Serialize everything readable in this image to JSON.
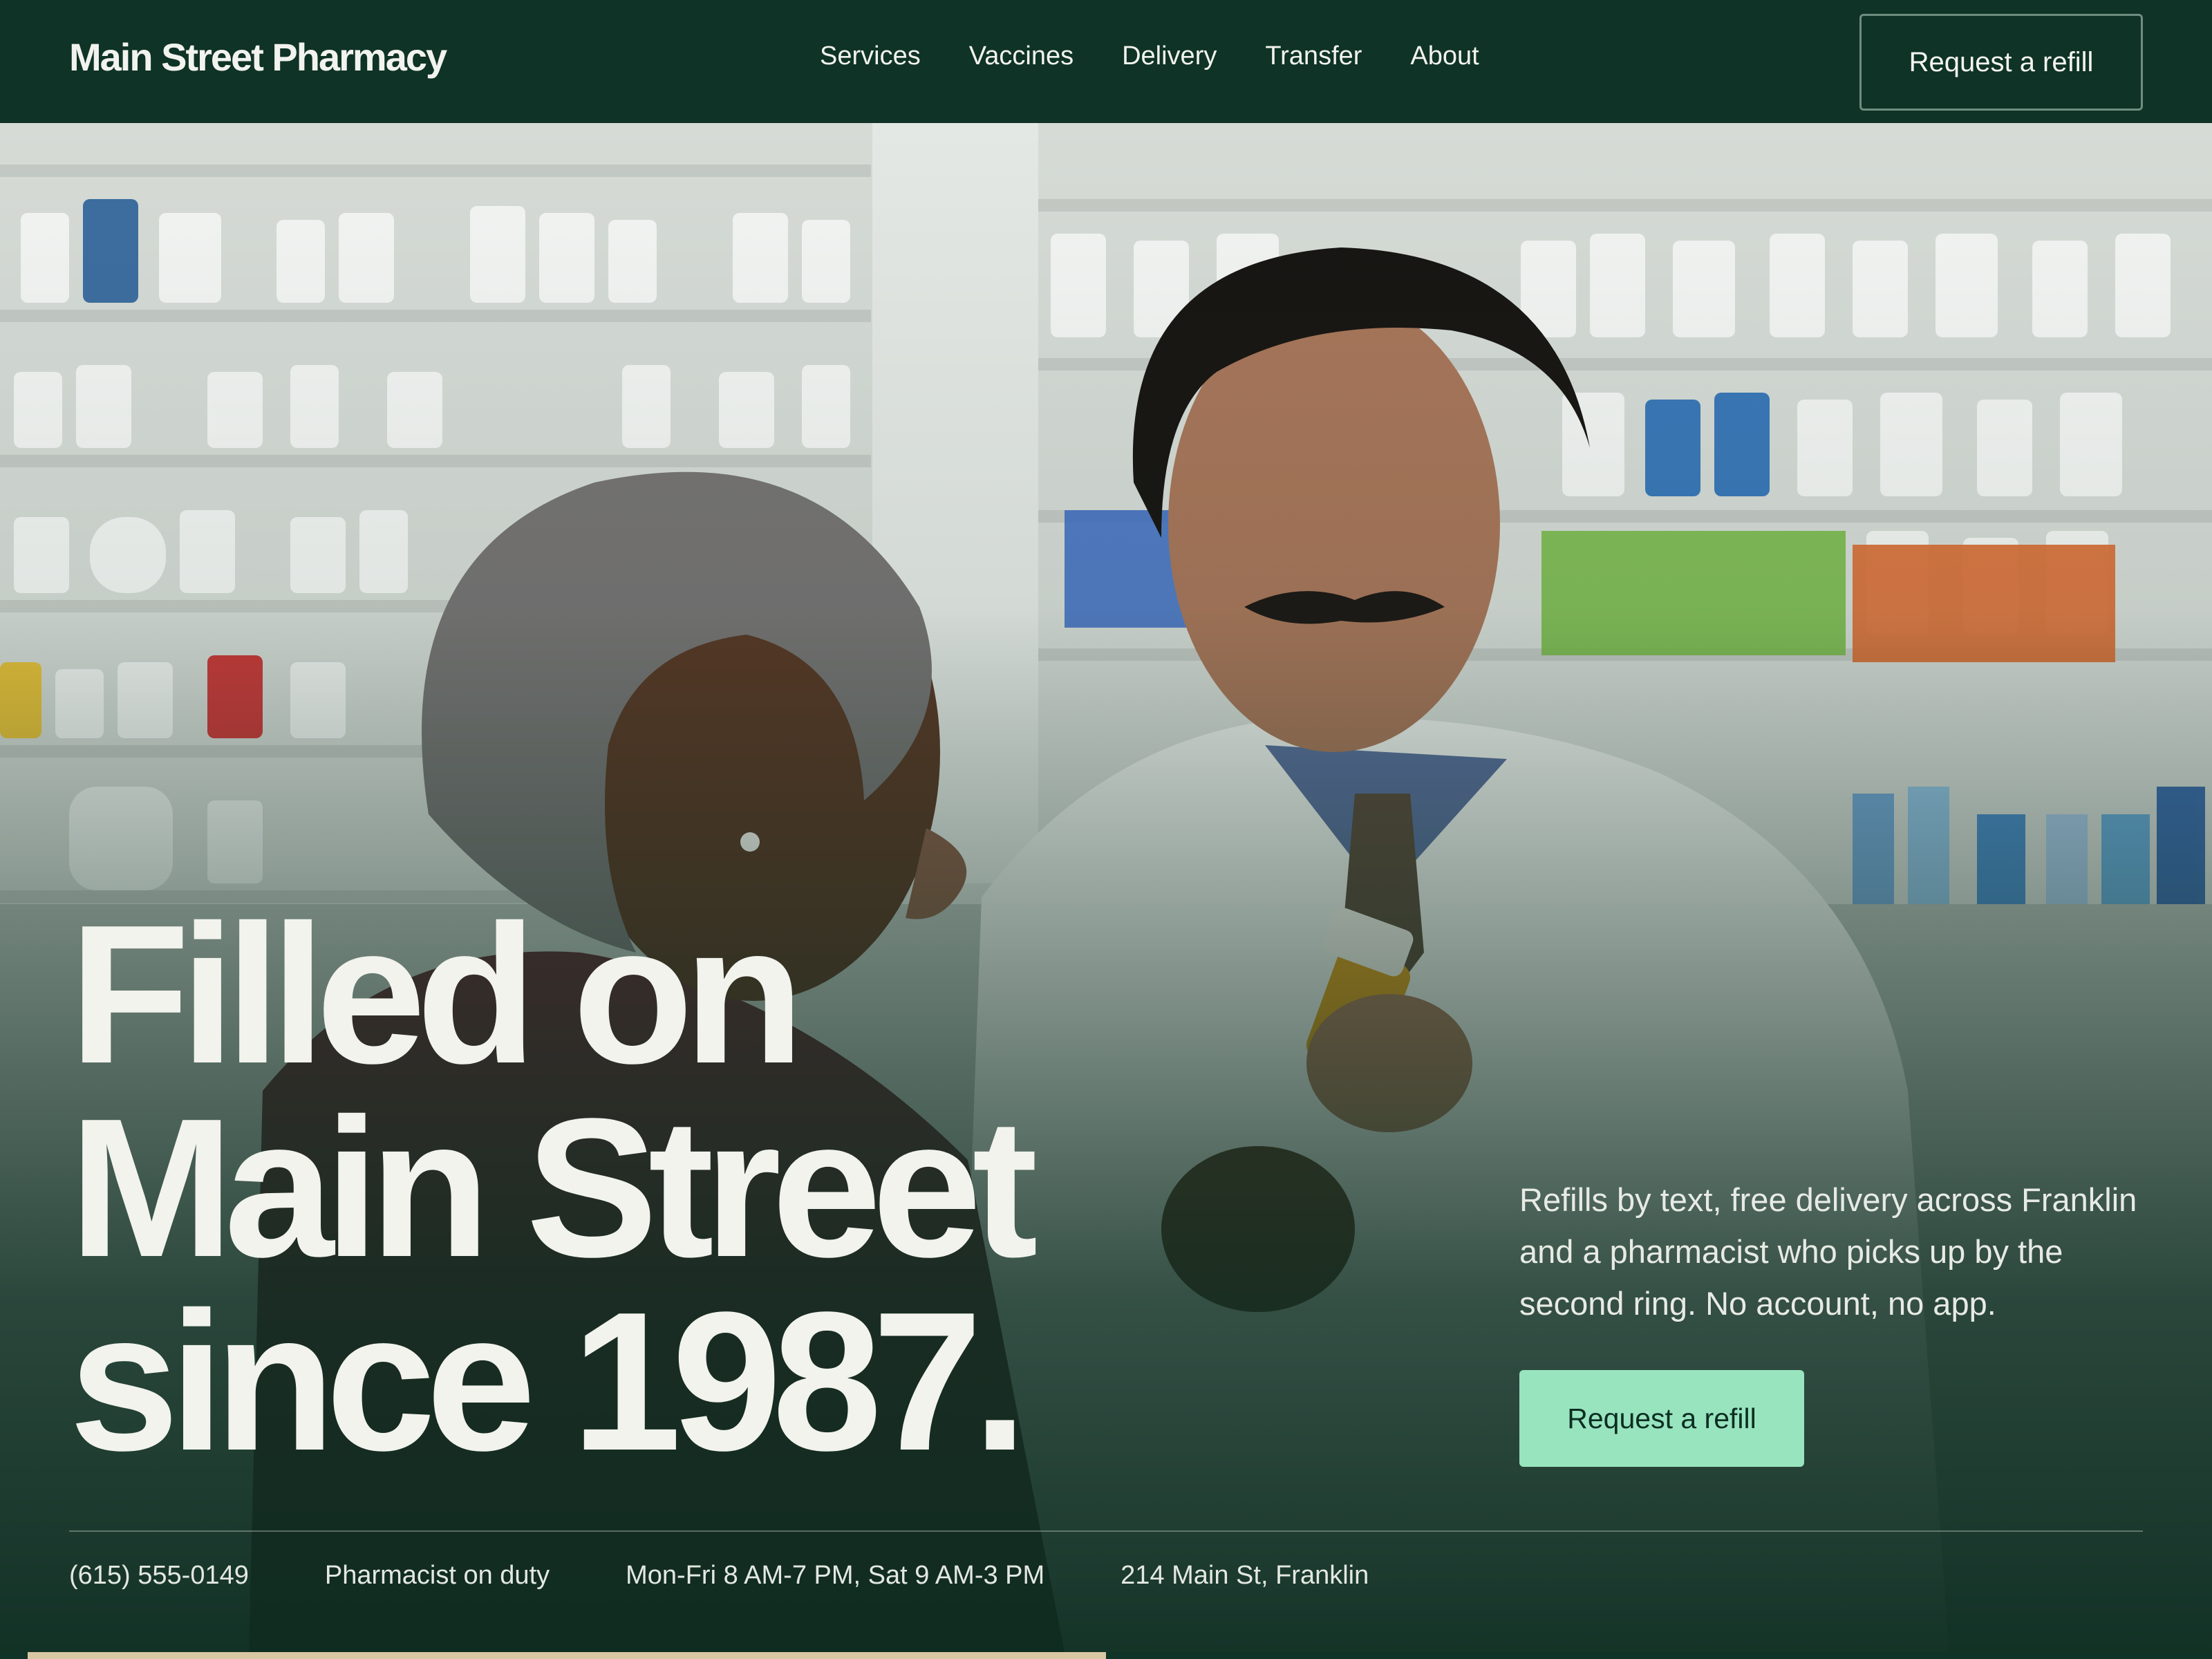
{
  "brand": {
    "name": "Main Street Pharmacy"
  },
  "nav": {
    "links": [
      "Services",
      "Vaccines",
      "Delivery",
      "Transfer",
      "About"
    ],
    "cta_label": "Request a refill"
  },
  "hero": {
    "heading_lines": [
      "Filled on",
      "Main Street",
      "since 1987."
    ],
    "subtext": "Refills by text, free delivery across Franklin and a pharmacist who picks up by the second ring. No account, no app.",
    "cta_label": "Request a refill",
    "info": {
      "phone": "(615) 555-0149",
      "status": "Pharmacist on duty",
      "hours": "Mon-Fri 8 AM-7 PM, Sat 9 AM-3 PM",
      "address": "214 Main St, Franklin"
    }
  },
  "colors": {
    "nav_background": "#0f3326",
    "text_light": "#f2f3ee",
    "accent_button": "#98e4bf",
    "accent_button_text": "#0c2e22"
  }
}
